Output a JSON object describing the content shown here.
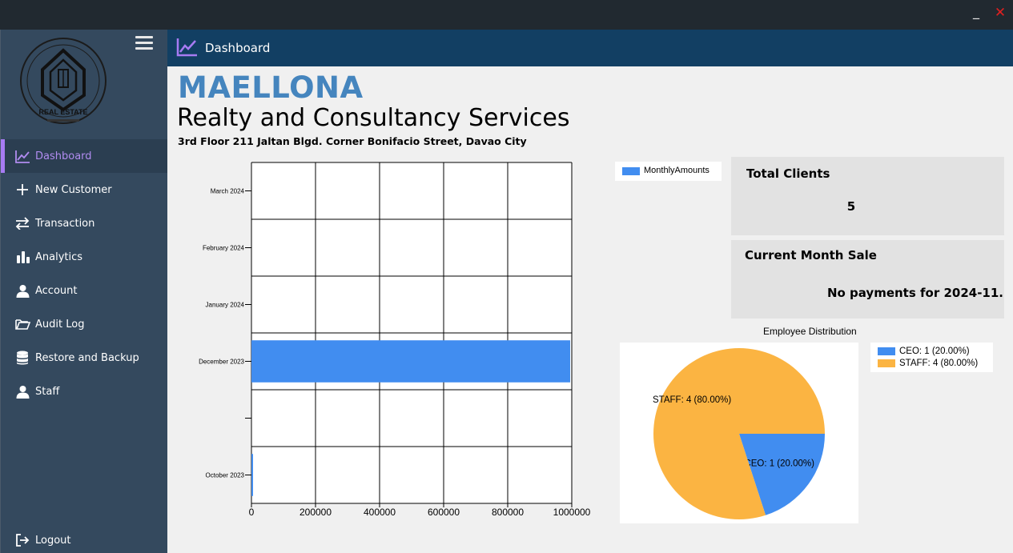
{
  "window": {
    "minimize_label": "_",
    "close_label": "✕"
  },
  "header": {
    "title": "Dashboard",
    "icon": "line-chart-icon"
  },
  "sidebar": {
    "items": [
      {
        "label": "Dashboard",
        "icon": "line-chart-icon",
        "active": true
      },
      {
        "label": "New Customer",
        "icon": "plus-icon"
      },
      {
        "label": "Transaction",
        "icon": "swap-arrows-icon"
      },
      {
        "label": "Analytics",
        "icon": "bar-chart-icon"
      },
      {
        "label": "Account",
        "icon": "user-icon"
      },
      {
        "label": "Audit Log",
        "icon": "folder-open-icon"
      },
      {
        "label": "Restore and Backup",
        "icon": "database-icon"
      },
      {
        "label": "Staff",
        "icon": "user-icon"
      }
    ],
    "logout_label": "Logout",
    "logo_text": "REAL ESTATE"
  },
  "company": {
    "name": "MAELLONA",
    "subtitle": "Realty and Consultancy Services",
    "address": "3rd Floor 211 Jaltan Blgd. Corner Bonifacio Street, Davao City"
  },
  "cards": {
    "total_clients": {
      "label": "Total Clients",
      "value": "5"
    },
    "current_month_sale": {
      "label": "Current Month Sale",
      "value": "No payments for 2024-11."
    }
  },
  "colors": {
    "accent": "#a77bf3",
    "brand": "#4585be",
    "header": "#123f63",
    "sidebar": "#34495e",
    "bar": "#418df0",
    "pie_staff": "#fbb442",
    "pie_ceo": "#418df0"
  },
  "chart_data": [
    {
      "type": "bar",
      "orientation": "horizontal",
      "series": [
        {
          "name": "MonthlyAmounts",
          "color": "#418df0"
        }
      ],
      "categories": [
        "March 2024",
        "February 2024",
        "January 2024",
        "December 2023",
        "",
        "October 2023"
      ],
      "values": [
        0,
        0,
        0,
        995000,
        0,
        5000
      ],
      "xlim": [
        0,
        1000000
      ],
      "xticks": [
        "0",
        "200000",
        "400000",
        "600000",
        "800000",
        "1000000"
      ],
      "legend_position": "top-right",
      "grid": true
    },
    {
      "type": "pie",
      "title": "Employee Distribution",
      "slices": [
        {
          "label": "CEO: 1 (20.00%)",
          "value": 1,
          "color": "#418df0"
        },
        {
          "label": "STAFF: 4 (80.00%)",
          "value": 4,
          "color": "#fbb442"
        }
      ],
      "legend_position": "right"
    }
  ]
}
